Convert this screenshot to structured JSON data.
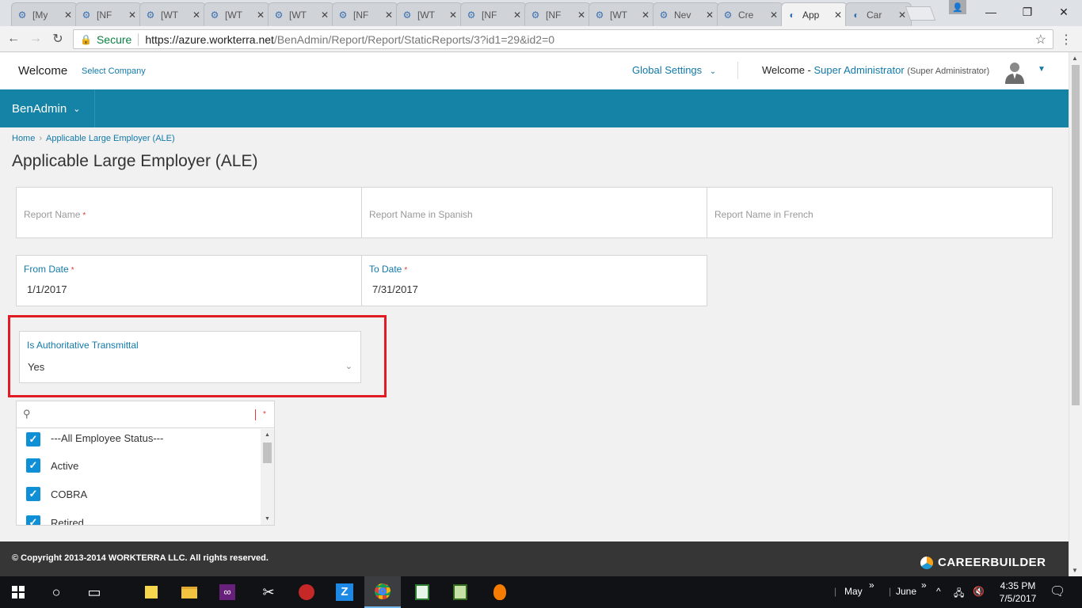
{
  "browser": {
    "tabs": [
      {
        "label": "[My",
        "icon": "workterra-icon"
      },
      {
        "label": "[NF",
        "icon": "workterra-icon"
      },
      {
        "label": "[WT",
        "icon": "workterra-icon"
      },
      {
        "label": "[WT",
        "icon": "workterra-icon"
      },
      {
        "label": "[WT",
        "icon": "workterra-icon"
      },
      {
        "label": "[NF",
        "icon": "workterra-icon"
      },
      {
        "label": "[WT",
        "icon": "workterra-icon"
      },
      {
        "label": "[NF",
        "icon": "workterra-icon"
      },
      {
        "label": "[NF",
        "icon": "workterra-icon"
      },
      {
        "label": "[WT",
        "icon": "workterra-icon"
      },
      {
        "label": "Nev",
        "icon": "workterra-icon"
      },
      {
        "label": "Cre",
        "icon": "workterra-icon"
      },
      {
        "label": "App",
        "icon": "page-icon",
        "active": true
      },
      {
        "label": "Car",
        "icon": "page-icon"
      }
    ],
    "secure_label": "Secure",
    "url_host": "https://azure.workterra.net",
    "url_path": "/BenAdmin/Report/Report/StaticReports/3?id1=29&id2=0"
  },
  "header": {
    "welcome": "Welcome",
    "select_company": "Select Company",
    "global_settings": "Global Settings",
    "welcome_user_prefix": "Welcome - ",
    "user_name": "Super Administrator",
    "user_role": "(Super Administrator)"
  },
  "nav": {
    "module": "BenAdmin"
  },
  "breadcrumb": {
    "home": "Home",
    "current": "Applicable Large Employer (ALE)"
  },
  "page": {
    "title": "Applicable Large Employer (ALE)"
  },
  "form": {
    "report_name_placeholder": "Report Name",
    "report_name_spanish_placeholder": "Report Name in Spanish",
    "report_name_french_placeholder": "Report Name in French",
    "from_date_label": "From Date",
    "from_date_value": "1/1/2017",
    "to_date_label": "To Date",
    "to_date_value": "7/31/2017",
    "authoritative_label": "Is Authoritative Transmittal",
    "authoritative_value": "Yes",
    "required_mark": "*"
  },
  "employee_status": {
    "search_value": "",
    "items": [
      {
        "label": "---All Employee Status---",
        "checked": true
      },
      {
        "label": "Active",
        "checked": true
      },
      {
        "label": "COBRA",
        "checked": true
      },
      {
        "label": "Retired",
        "checked": true
      }
    ]
  },
  "footer": {
    "copyright": "© Copyright 2013-2014 WORKTERRA LLC. All rights reserved.",
    "brand": "CAREERBUILDER"
  },
  "taskbar": {
    "tray_may": "May",
    "tray_june": "June",
    "time": "4:35 PM",
    "date": "7/5/2017"
  },
  "colors": {
    "accent": "#1483a5",
    "link": "#1279a8",
    "highlight": "#e01b24",
    "checkbox": "#0f8fd6"
  }
}
